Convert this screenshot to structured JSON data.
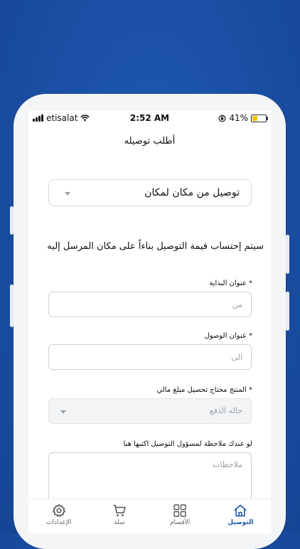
{
  "status_bar": {
    "carrier": "etisalat",
    "time": "2:52 AM",
    "battery": "41%",
    "battery_fill": 0.41
  },
  "page_title": "أطلب توصيله",
  "delivery_type": {
    "selected": "توصيل من مكان لمكان"
  },
  "info_text": "سيتم إحتساب قيمة التوصيل بناءاً على مكان المرسل إليه",
  "start_address": {
    "label": "* عنوان البداية",
    "placeholder": "من"
  },
  "arrival_address": {
    "label": "* عنوان الوصول",
    "placeholder": "الى"
  },
  "payment": {
    "label": "* المنتج محتاج تحصيل مبلغ مالي",
    "placeholder": "حاله الدفع"
  },
  "notes": {
    "label": "لو عندك ملاحظة لمسؤول التوصيل اكتبها هنا",
    "placeholder": "ملاحظات"
  },
  "tabs": [
    {
      "label": "التوصيل",
      "icon": "home-icon",
      "active": true
    },
    {
      "label": "الأقسام",
      "icon": "grid-icon",
      "active": false
    },
    {
      "label": "سلة",
      "icon": "cart-icon",
      "active": false
    },
    {
      "label": "الإعدادات",
      "icon": "gear-icon",
      "active": false
    }
  ],
  "colors": {
    "background": "#1a4fa3",
    "accent": "#1a56a6",
    "battery": "#f2c200"
  }
}
